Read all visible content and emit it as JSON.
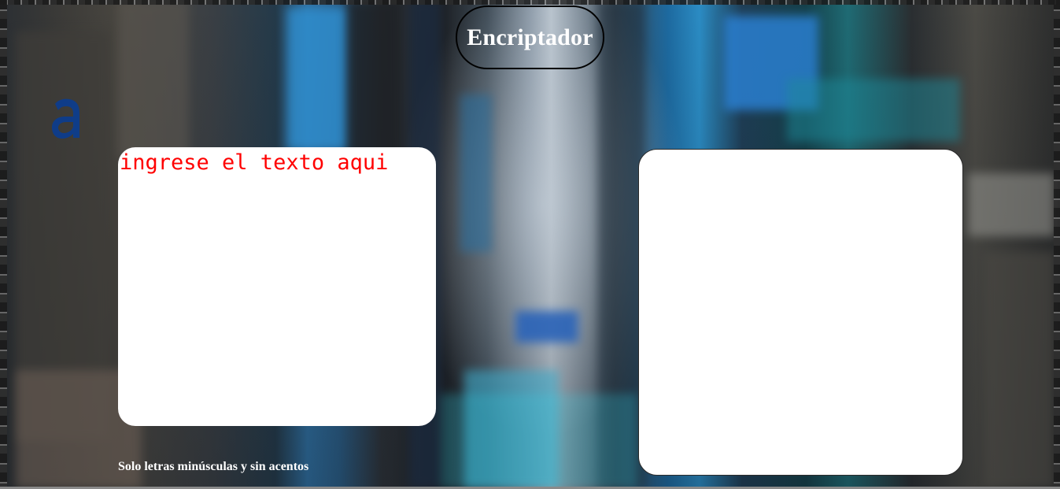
{
  "header": {
    "title": "Encriptador"
  },
  "logo": {
    "icon": "alura-a-logo-icon",
    "color": "#0a3d91"
  },
  "input": {
    "value": "",
    "placeholder": "ingrese el texto aqui",
    "placeholder_color": "#ff0000"
  },
  "output": {
    "value": ""
  },
  "footer": {
    "hint": "Solo letras minúsculas y sin acentos"
  }
}
